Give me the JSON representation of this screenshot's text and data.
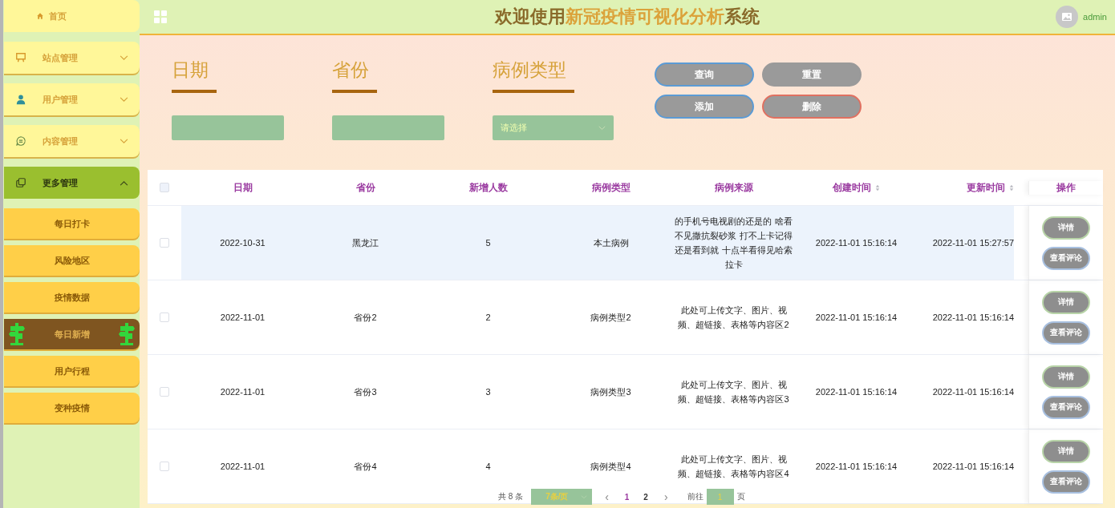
{
  "header": {
    "title": [
      {
        "text": "欢迎使用",
        "highlight": false
      },
      {
        "text": "新冠疫情可视化分析",
        "highlight": true
      },
      {
        "text": "系统",
        "highlight": false
      }
    ],
    "user": "admin"
  },
  "sidebar": {
    "items": [
      {
        "label": "首页",
        "selected": false
      },
      {
        "label": "站点管理",
        "selected": false,
        "expanded": false
      },
      {
        "label": "用户管理",
        "selected": false,
        "expanded": false
      },
      {
        "label": "内容管理",
        "selected": false,
        "expanded": false
      },
      {
        "label": "更多管理",
        "selected": true,
        "expanded": true,
        "children": [
          {
            "label": "每日打卡",
            "selected": false
          },
          {
            "label": "风险地区",
            "selected": false
          },
          {
            "label": "疫情数据",
            "selected": false
          },
          {
            "label": "每日新增",
            "selected": true
          },
          {
            "label": "用户行程",
            "selected": false
          },
          {
            "label": "变种疫情",
            "selected": false
          }
        ]
      }
    ]
  },
  "search": {
    "fields": [
      {
        "label": "日期",
        "kind": "input"
      },
      {
        "label": "省份",
        "kind": "input"
      },
      {
        "label": "病例类型",
        "kind": "select",
        "placeholder": "请选择"
      }
    ],
    "buttons": [
      {
        "label": "查询",
        "kind": "primary"
      },
      {
        "label": "重置",
        "kind": "plain"
      },
      {
        "label": "添加",
        "kind": "primary"
      },
      {
        "label": "删除",
        "kind": "danger"
      }
    ]
  },
  "table": {
    "all_checked": false,
    "columns": [
      {
        "label": "日期"
      },
      {
        "label": "省份"
      },
      {
        "label": "新增人数"
      },
      {
        "label": "病例类型"
      },
      {
        "label": "病例来源"
      },
      {
        "label": "创建时间",
        "sortable": true
      },
      {
        "label": "更新时间",
        "sortable": true
      },
      {
        "label": "操作"
      }
    ],
    "rows": [
      {
        "checked": false,
        "highlighted": true,
        "cells": [
          "2022-10-31",
          "黑龙江",
          "5",
          "本土病例",
          "的手机号电视剧的还是的 啥看不见撒抗裂砂浆 打不上卡记得还是看到就 十点半看得见哈索拉卡",
          "2022-11-01 15:16:14",
          "2022-11-01 15:27:57"
        ],
        "actions": [
          "详情",
          "查看评论"
        ]
      },
      {
        "checked": false,
        "highlighted": false,
        "cells": [
          "2022-11-01",
          "省份2",
          "2",
          "病例类型2",
          "此处可上传文字、图片、视频、超链接、表格等内容区2",
          "2022-11-01 15:16:14",
          "2022-11-01 15:16:14"
        ],
        "actions": [
          "详情",
          "查看评论"
        ]
      },
      {
        "checked": false,
        "highlighted": false,
        "cells": [
          "2022-11-01",
          "省份3",
          "3",
          "病例类型3",
          "此处可上传文字、图片、视频、超链接、表格等内容区3",
          "2022-11-01 15:16:14",
          "2022-11-01 15:16:14"
        ],
        "actions": [
          "详情",
          "查看评论"
        ]
      },
      {
        "checked": false,
        "highlighted": false,
        "cells": [
          "2022-11-01",
          "省份4",
          "4",
          "病例类型4",
          "此处可上传文字、图片、视频、超链接、表格等内容区4",
          "2022-11-01 15:16:14",
          "2022-11-01 15:16:14"
        ],
        "actions": [
          "详情",
          "查看评论"
        ]
      }
    ]
  },
  "pagination": {
    "total": "共 8 条",
    "page_size": "7条/页",
    "prev": "‹",
    "pages": [
      {
        "label": "1",
        "selected": true
      },
      {
        "label": "2",
        "selected": false
      }
    ],
    "next": "›",
    "goto": "前往",
    "goto_value": "1",
    "goto_unit": "页"
  }
}
